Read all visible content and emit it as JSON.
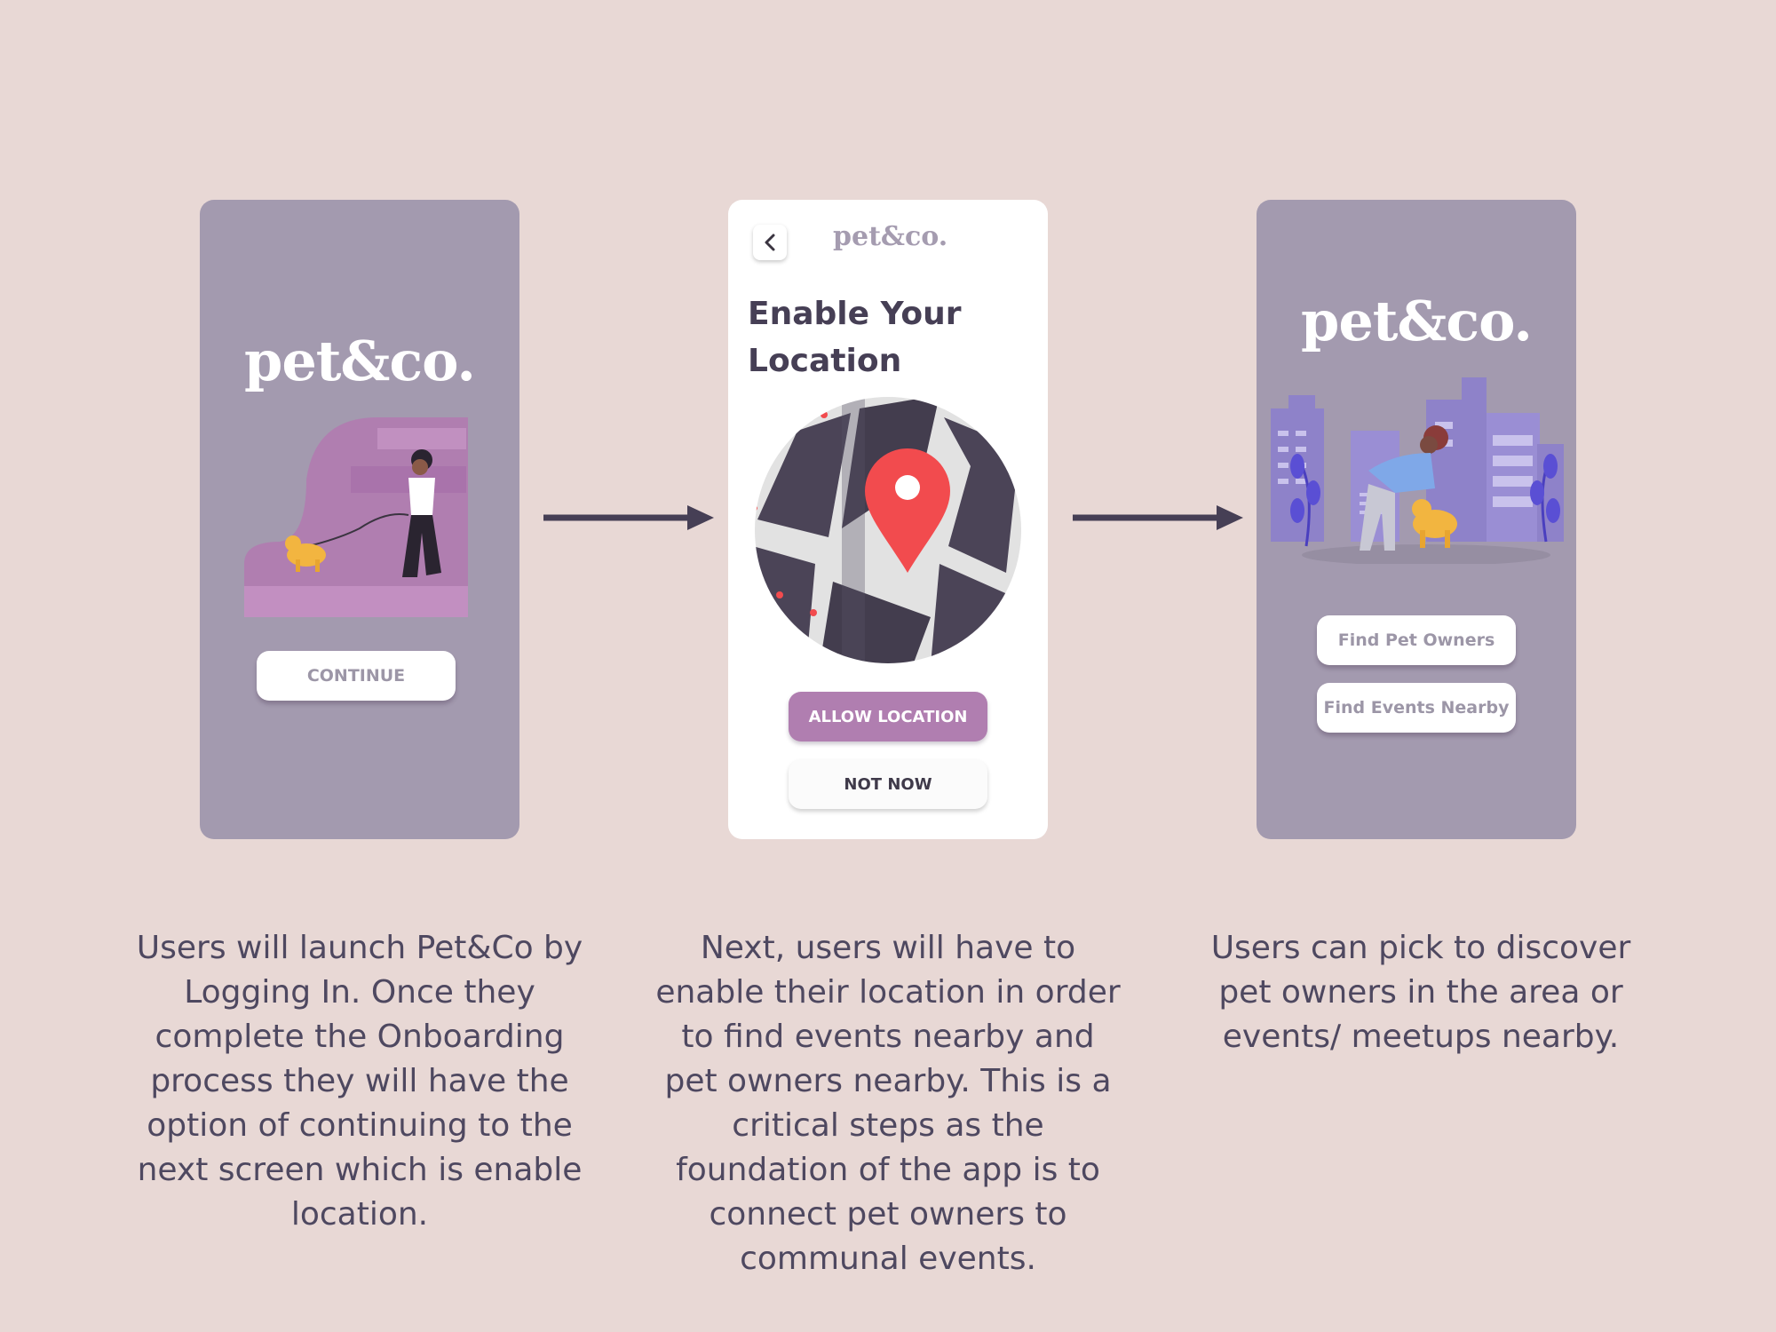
{
  "screens": {
    "splash": {
      "logo": "pet&co.",
      "continue_label": "CONTINUE"
    },
    "location": {
      "logo": "pet&co.",
      "title_lines": [
        "Enable Your",
        "Location"
      ],
      "allow_label": "ALLOW LOCATION",
      "not_now_label": "NOT NOW"
    },
    "discover": {
      "logo": "pet&co.",
      "find_owners_label": "Find Pet Owners",
      "find_events_label": "Find Events Nearby"
    }
  },
  "descriptions": [
    {
      "lines": [
        "Users will launch Pet&Co by",
        "Logging In. Once they",
        "complete the Onboarding",
        "process they will have the",
        "option of continuing to the",
        "next screen which is enable",
        "location."
      ]
    },
    {
      "lines": [
        "Next, users will have to",
        "enable their location in order",
        "to find events nearby and",
        "pet owners nearby. This is a",
        "critical steps as the",
        "foundation of the app is to",
        "connect pet owners to",
        "communal events."
      ]
    },
    {
      "lines": [
        "Users can pick to discover",
        "pet owners in the area or",
        "events/ meetups nearby."
      ]
    }
  ],
  "colors": {
    "background": "#e8d8d5",
    "phone_purple": "#a39aaf",
    "accent": "#b07eb0",
    "text_dark": "#4e4860",
    "pin_red": "#f24b4e"
  }
}
